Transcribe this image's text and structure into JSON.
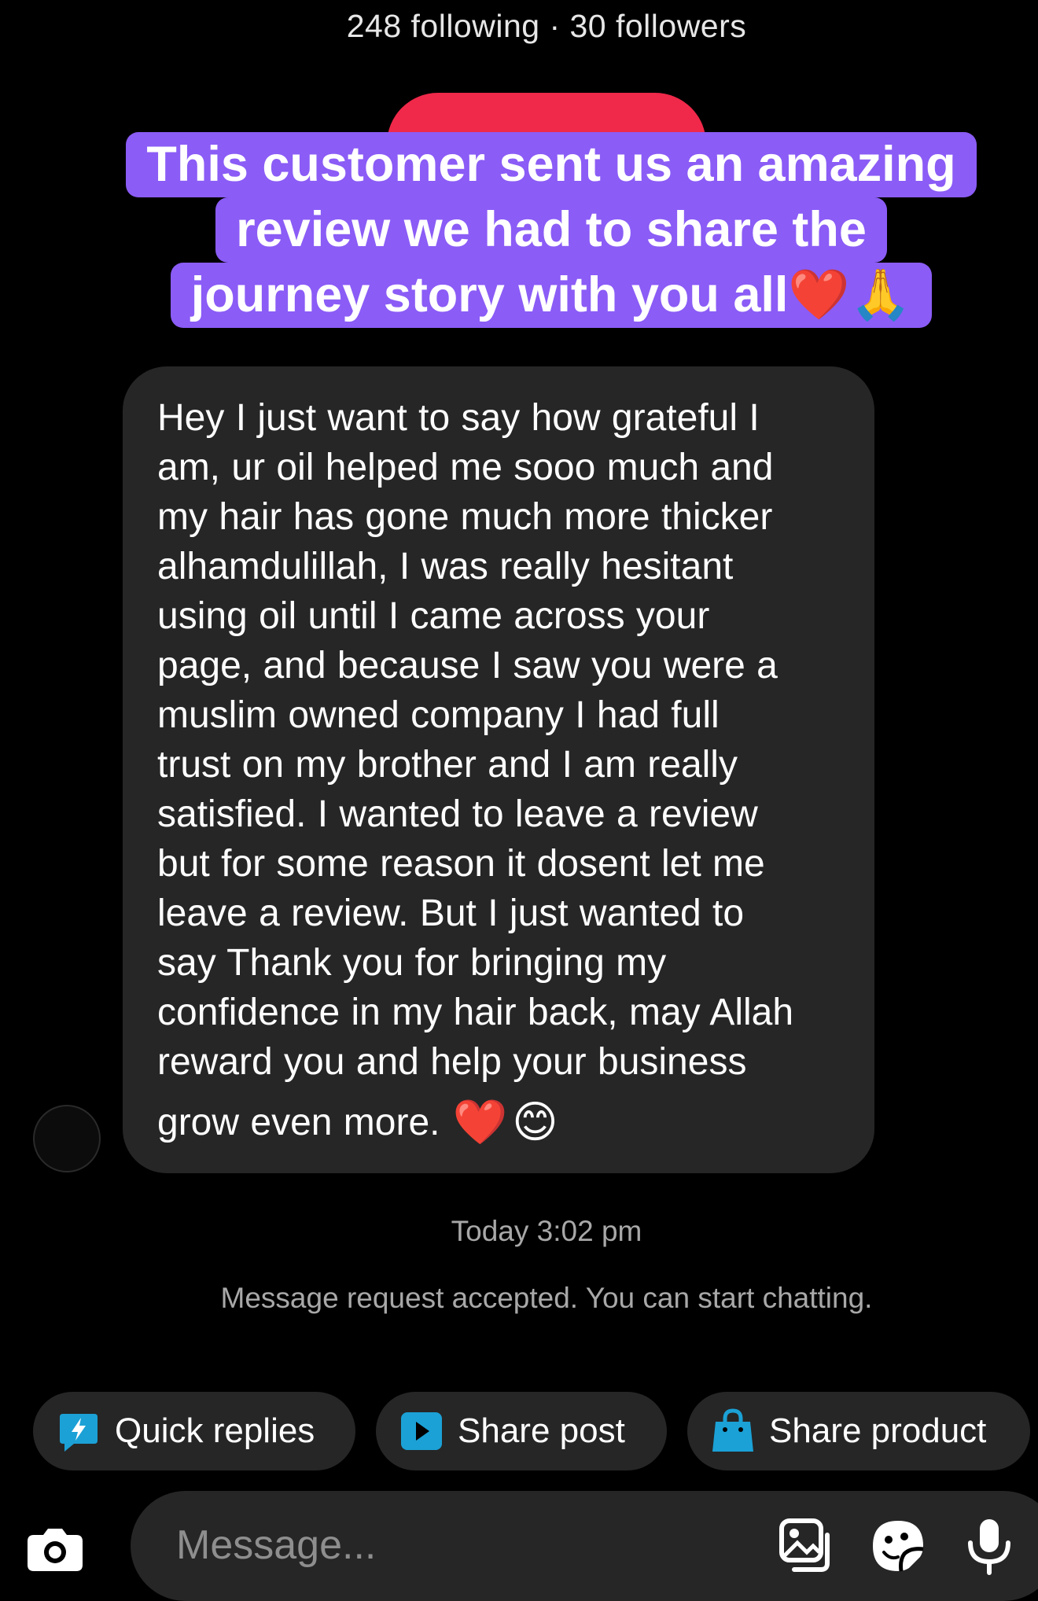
{
  "profile": {
    "stats": "248 following · 30 followers"
  },
  "banner": {
    "lines": [
      "This customer sent us an amazing",
      "review we had to share the",
      "journey story with you all❤️🙏"
    ]
  },
  "message": {
    "text": "Hey I just want to say how grateful I\nam, ur oil helped me sooo much and\nmy hair has gone much more thicker\nalhamdulillah, I was really hesitant\nusing oil until I came across your\npage, and because I saw you were a\nmuslim owned company I had full\ntrust on my brother and I am really\nsatisfied. I wanted to leave a review\nbut for some reason it dosent let me\nleave a review. But I just wanted to\nsay Thank you for bringing my\nconfidence in my hair back, may Allah\nreward you and help your business",
    "last_line": "grow even more.",
    "emojis": [
      "❤️",
      "😊"
    ]
  },
  "conversation": {
    "timestamp": "Today 3:02 pm",
    "notice": "Message request accepted. You can start chatting."
  },
  "quick_actions": [
    {
      "label": "Quick replies",
      "icon": "quick-replies-icon"
    },
    {
      "label": "Share post",
      "icon": "share-post-icon"
    },
    {
      "label": "Share product",
      "icon": "shopping-bag-icon"
    }
  ],
  "composer": {
    "placeholder": "Message...",
    "icons": [
      "camera-icon",
      "gallery-icon",
      "sticker-icon",
      "microphone-icon"
    ]
  },
  "colors": {
    "background": "#000000",
    "bubble": "#262626",
    "banner": "#8b5cf6",
    "accent_red": "#f0284a",
    "icon_blue": "#0095f6"
  }
}
